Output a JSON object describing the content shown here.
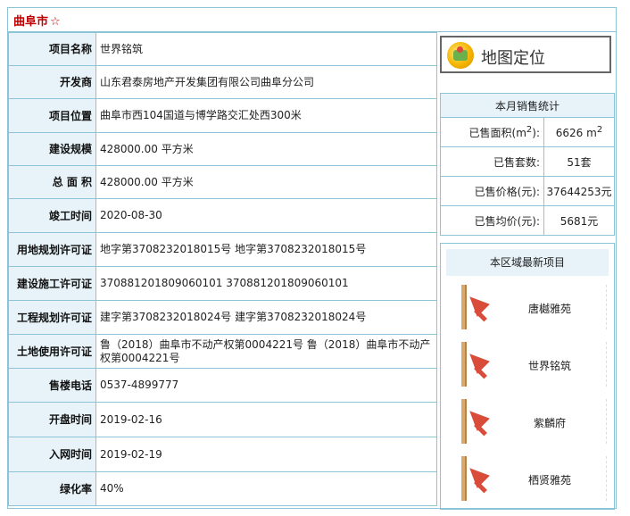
{
  "title": {
    "city": "曲阜市",
    "star": "☆"
  },
  "info_rows": [
    {
      "label": "项目名称",
      "value": "世界铭筑"
    },
    {
      "label": "开发商",
      "value": "山东君泰房地产开发集团有限公司曲阜分公司"
    },
    {
      "label": "项目位置",
      "value": "曲阜市西104国道与博学路交汇处西300米"
    },
    {
      "label": "建设规模",
      "value": "428000.00 平方米"
    },
    {
      "label": "总 面 积",
      "value": "428000.00 平方米"
    },
    {
      "label": "竣工时间",
      "value": "2020-08-30"
    },
    {
      "label": "用地规划许可证",
      "value": "地字第3708232018015号 地字第3708232018015号"
    },
    {
      "label": "建设施工许可证",
      "value": "370881201809060101 370881201809060101"
    },
    {
      "label": "工程规划许可证",
      "value": "建字第3708232018024号 建字第3708232018024号"
    },
    {
      "label": "土地使用许可证",
      "value": "鲁（2018）曲阜市不动产权第0004221号 鲁（2018）曲阜市不动产权第0004221号"
    },
    {
      "label": "售楼电话",
      "value": "0537-4899777"
    },
    {
      "label": "开盘时间",
      "value": "2019-02-16"
    },
    {
      "label": "入网时间",
      "value": "2019-02-19"
    },
    {
      "label": "绿化率",
      "value": "40%"
    }
  ],
  "map_button": {
    "label": "地图定位",
    "icon": "map-pin-icon"
  },
  "stats": {
    "header": "本月销售统计",
    "rows": [
      {
        "label_prefix": "已售面积(m",
        "label_sup": "2",
        "label_suffix": "):",
        "value": "6626 m",
        "value_sup": "2"
      },
      {
        "label_prefix": "已售套数:",
        "label_sup": "",
        "label_suffix": "",
        "value": "51套",
        "value_sup": ""
      },
      {
        "label_prefix": "已售价格(元):",
        "label_sup": "",
        "label_suffix": "",
        "value": "37644253元",
        "value_sup": ""
      },
      {
        "label_prefix": "已售均价(元):",
        "label_sup": "",
        "label_suffix": "",
        "value": "5681元",
        "value_sup": ""
      }
    ]
  },
  "latest_projects": {
    "header": "本区域最新项目",
    "items": [
      {
        "name": "唐樾雅苑"
      },
      {
        "name": "世界铭筑"
      },
      {
        "name": "紫麟府"
      },
      {
        "name": "栖贤雅苑"
      }
    ]
  },
  "colors": {
    "title": "#c00000",
    "border": "#8cc4d6",
    "label_bg": "#e7f3f8"
  }
}
